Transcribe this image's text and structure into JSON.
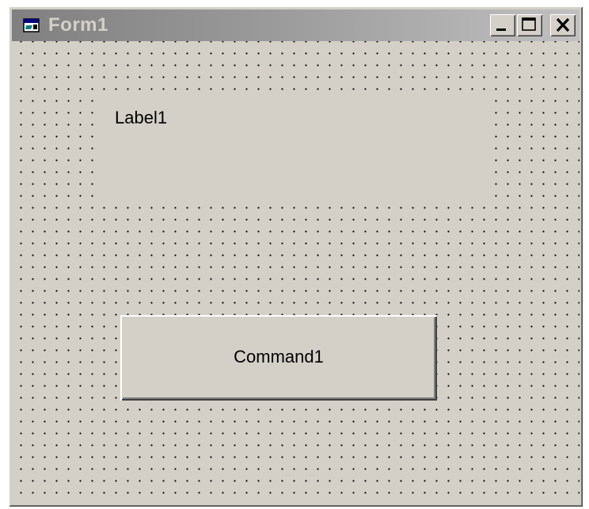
{
  "window": {
    "title": "Form1",
    "title_icon": "form-icon",
    "controls": {
      "minimize_icon": "minimize-icon",
      "maximize_icon": "maximize-icon",
      "close_icon": "close-icon"
    },
    "colors": {
      "face": "#d4d0c8",
      "title_gradient_start": "#808080",
      "title_gradient_end": "#c0c0c0",
      "title_text": "#d4d0c8",
      "grid_dots": "#000000"
    }
  },
  "form": {
    "label1": {
      "caption": "Label1"
    },
    "command1": {
      "caption": "Command1"
    }
  }
}
